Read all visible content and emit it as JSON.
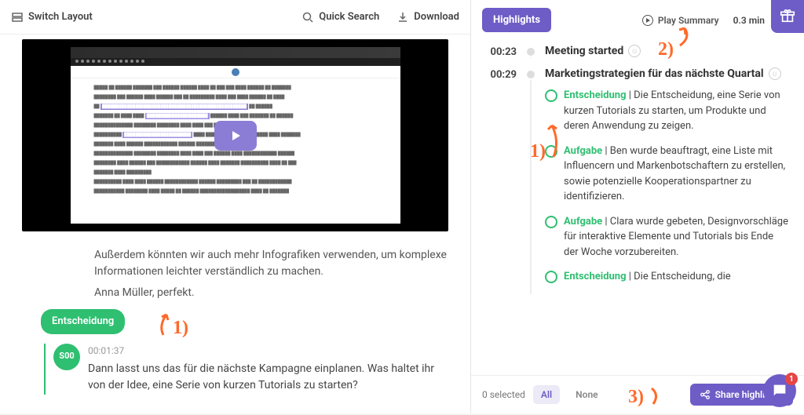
{
  "toolbar": {
    "switchLayout": "Switch Layout",
    "quickSearch": "Quick Search",
    "download": "Download"
  },
  "transcript": {
    "line1": "Außerdem könnten wir auch mehr Infografiken verwenden, um komplexe Informationen leichter verständlich zu machen.",
    "line2": "Anna Müller, perfekt.",
    "tag": "Entscheidung",
    "entry": {
      "speaker": "S00",
      "time": "00:01:37",
      "text": "Dann lasst uns das für die nächste Kampagne einplanen. Was haltet ihr von der Idee, eine Serie von kurzen Tutorials zu starten?"
    }
  },
  "right": {
    "highlightsBtn": "Highlights",
    "playSummary": "Play Summary",
    "duration": "0.3 min",
    "timeline": [
      {
        "time": "00:23",
        "title": "Meeting started",
        "items": []
      },
      {
        "time": "00:29",
        "title": "Marketingstrategien für das nächste Quartal",
        "items": [
          {
            "tag": "Entscheidung",
            "text": "Die Entscheidung, eine Serie von kurzen Tutorials zu starten, um Produkte und deren Anwendung zu zeigen."
          },
          {
            "tag": "Aufgabe",
            "text": "Ben wurde beauftragt, eine Liste mit Influencern und Markenbotschaftern zu erstellen, sowie potenzielle Kooperationspartner zu identifizieren."
          },
          {
            "tag": "Aufgabe",
            "text": "Clara wurde gebeten, Designvorschläge für interaktive Elemente und Tutorials bis Ende der Woche vorzubereiten."
          },
          {
            "tag": "Entscheidung",
            "text": "Die Entscheidung, die"
          }
        ]
      }
    ],
    "footer": {
      "selected": "0 selected",
      "filterAll": "All",
      "filterNone": "None",
      "share": "Share highlights"
    }
  },
  "annotations": {
    "one": "1)",
    "two": "2)",
    "three": "3)"
  },
  "chatBadge": "1"
}
